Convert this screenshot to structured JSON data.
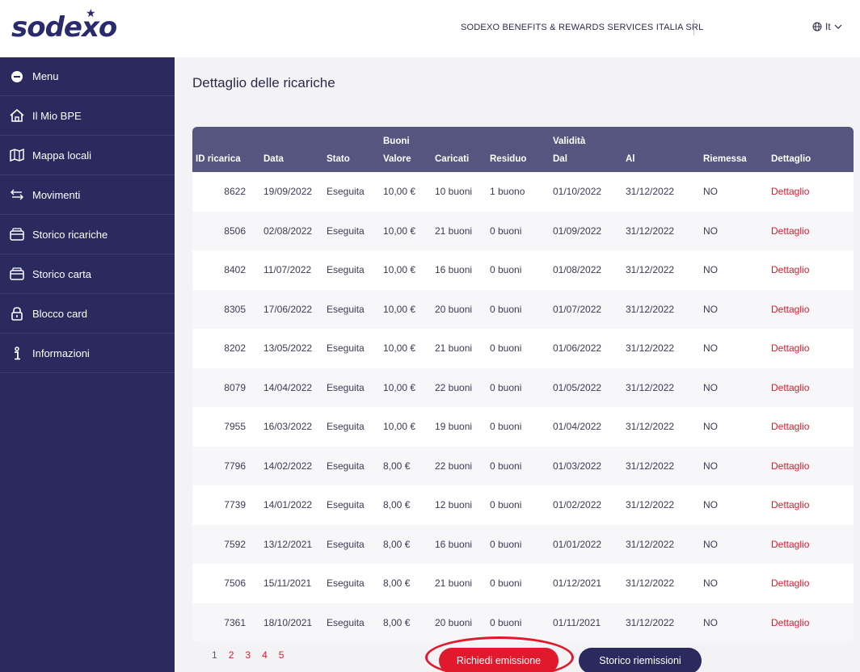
{
  "header": {
    "logo": "sodexo",
    "company": "SODEXO BENEFITS & REWARDS SERVICES ITALIA SRL",
    "lang": "It"
  },
  "sidebar": {
    "items": [
      {
        "label": "Menu",
        "icon": "menu-icon"
      },
      {
        "label": "Il Mio BPE",
        "icon": "home-icon"
      },
      {
        "label": "Mappa locali",
        "icon": "map-icon"
      },
      {
        "label": "Movimenti",
        "icon": "arrows-icon"
      },
      {
        "label": "Storico ricariche",
        "icon": "card-icon"
      },
      {
        "label": "Storico carta",
        "icon": "card-icon"
      },
      {
        "label": "Blocco card",
        "icon": "lock-icon"
      },
      {
        "label": "Informazioni",
        "icon": "info-icon"
      }
    ]
  },
  "main": {
    "title": "Dettaglio delle ricariche",
    "group_headers": {
      "buoni": "Buoni",
      "validita": "Validità"
    },
    "columns": [
      "ID ricarica",
      "Data",
      "Stato",
      "Valore",
      "Caricati",
      "Residuo",
      "Dal",
      "Al",
      "Riemessa",
      "Dettaglio"
    ],
    "rows": [
      [
        "8622",
        "19/09/2022",
        "Eseguita",
        "10,00 €",
        "10 buoni",
        "1 buono",
        "01/10/2022",
        "31/12/2022",
        "NO",
        "Dettaglio"
      ],
      [
        "8506",
        "02/08/2022",
        "Eseguita",
        "10,00 €",
        "21 buoni",
        "0 buoni",
        "01/09/2022",
        "31/12/2022",
        "NO",
        "Dettaglio"
      ],
      [
        "8402",
        "11/07/2022",
        "Eseguita",
        "10,00 €",
        "16 buoni",
        "0 buoni",
        "01/08/2022",
        "31/12/2022",
        "NO",
        "Dettaglio"
      ],
      [
        "8305",
        "17/06/2022",
        "Eseguita",
        "10,00 €",
        "20 buoni",
        "0 buoni",
        "01/07/2022",
        "31/12/2022",
        "NO",
        "Dettaglio"
      ],
      [
        "8202",
        "13/05/2022",
        "Eseguita",
        "10,00 €",
        "21 buoni",
        "0 buoni",
        "01/06/2022",
        "31/12/2022",
        "NO",
        "Dettaglio"
      ],
      [
        "8079",
        "14/04/2022",
        "Eseguita",
        "10,00 €",
        "22 buoni",
        "0 buoni",
        "01/05/2022",
        "31/12/2022",
        "NO",
        "Dettaglio"
      ],
      [
        "7955",
        "16/03/2022",
        "Eseguita",
        "10,00 €",
        "19 buoni",
        "0 buoni",
        "01/04/2022",
        "31/12/2022",
        "NO",
        "Dettaglio"
      ],
      [
        "7796",
        "14/02/2022",
        "Eseguita",
        "8,00 €",
        "22 buoni",
        "0 buoni",
        "01/03/2022",
        "31/12/2022",
        "NO",
        "Dettaglio"
      ],
      [
        "7739",
        "14/01/2022",
        "Eseguita",
        "8,00 €",
        "12 buoni",
        "0 buoni",
        "01/02/2022",
        "31/12/2022",
        "NO",
        "Dettaglio"
      ],
      [
        "7592",
        "13/12/2021",
        "Eseguita",
        "8,00 €",
        "16 buoni",
        "0 buoni",
        "01/01/2022",
        "31/12/2022",
        "NO",
        "Dettaglio"
      ],
      [
        "7506",
        "15/11/2021",
        "Eseguita",
        "8,00 €",
        "21 buoni",
        "0 buoni",
        "01/12/2021",
        "31/12/2022",
        "NO",
        "Dettaglio"
      ],
      [
        "7361",
        "18/10/2021",
        "Eseguita",
        "8,00 €",
        "20 buoni",
        "0 buoni",
        "01/11/2021",
        "31/12/2022",
        "NO",
        "Dettaglio"
      ]
    ],
    "pagination": [
      "1",
      "2",
      "3",
      "4",
      "5"
    ],
    "current_page": "1",
    "buttons": {
      "richiedi": "Richiedi emissione",
      "storico": "Storico riemissioni"
    }
  },
  "colors": {
    "navy": "#2a2a5e",
    "header_row": "#55557f",
    "accent_red": "#e0192c"
  }
}
